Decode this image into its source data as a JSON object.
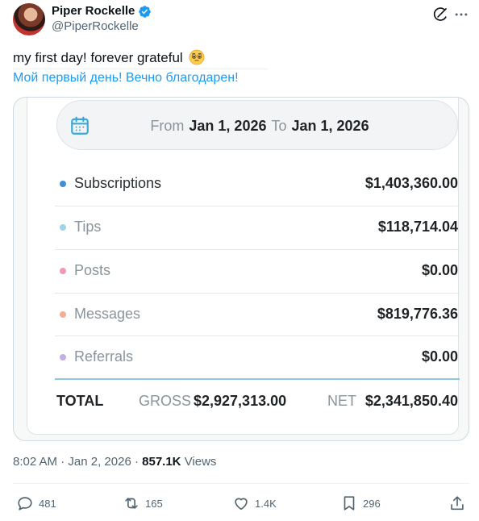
{
  "author": {
    "display_name": "Piper Rockelle",
    "handle": "@PiperRockelle",
    "verified": true
  },
  "icons": {
    "verified": "verified-badge-icon",
    "grok": "grok-icon",
    "more": "more-icon",
    "emoji": "pleading-face-emoji",
    "calendar": "calendar-icon"
  },
  "tweet": {
    "text": "my first day! forever grateful",
    "translation": "Мой первый день! Вечно благодарен!"
  },
  "media": {
    "date_range": {
      "from_label": "From",
      "from_value": "Jan 1, 2026",
      "to_label": "To",
      "to_value": "Jan 1, 2026"
    },
    "earnings": [
      {
        "label": "Subscriptions",
        "amount": "$1,403,360.00",
        "dot_color": "#3f8fd8",
        "label_color": "#2a2f33"
      },
      {
        "label": "Tips",
        "amount": "$118,714.04",
        "dot_color": "#9ed4e8",
        "label_color": "#8a949b"
      },
      {
        "label": "Posts",
        "amount": "$0.00",
        "dot_color": "#ef9ab2",
        "label_color": "#8a949b"
      },
      {
        "label": "Messages",
        "amount": "$819,776.36",
        "dot_color": "#f5ad93",
        "label_color": "#8a949b"
      },
      {
        "label": "Referrals",
        "amount": "$0.00",
        "dot_color": "#c3aee3",
        "label_color": "#8a949b"
      }
    ],
    "totals": {
      "total_label": "TOTAL",
      "gross_label": "GROSS",
      "gross_value": "$2,927,313.00",
      "net_label": "NET",
      "net_value": "$2,341,850.40"
    }
  },
  "meta": {
    "time": "8:02 AM",
    "separator": "·",
    "date": "Jan 2, 2026",
    "views_count": "857.1K",
    "views_label": "Views"
  },
  "actions": {
    "replies": "481",
    "reposts": "165",
    "likes": "1.4K",
    "bookmarks": "296"
  },
  "colors": {
    "accent": "#1d9bf0",
    "muted": "#536471"
  }
}
